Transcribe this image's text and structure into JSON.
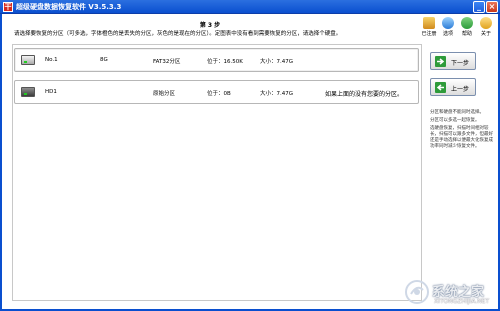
{
  "window": {
    "title": "超级硬盘数据恢复软件 V3.5.3.3",
    "icon": "app-logo-icon",
    "icon_glyph": "干"
  },
  "header": {
    "step": "第 3 步",
    "instruction": "请选择要恢复的分区（可多选，字体橙色的是丢失的分区，灰色的是现在的分区）。定图表中没有看到需要恢复的分区，请选择个硬盘。"
  },
  "top_icons": [
    {
      "name": "register-icon",
      "label": "已注册"
    },
    {
      "name": "options-icon",
      "label": "选项"
    },
    {
      "name": "help-icon",
      "label": "帮助"
    },
    {
      "name": "about-icon",
      "label": "关于"
    }
  ],
  "partitions": [
    {
      "name": "No.1",
      "size": "8G",
      "fs": "FAT32分区",
      "position": "位于：16.50K",
      "capacity": "大小：7.47G",
      "note": "",
      "icon": "drive-icon"
    },
    {
      "name": "HD1",
      "size": "",
      "fs": "原始分区",
      "position": "位于：0B",
      "capacity": "大小：7.47G",
      "note": "如果上面的没有您要的分区。",
      "icon": "hard-disk-icon"
    }
  ],
  "buttons": {
    "next": "下一步",
    "prev": "上一步"
  },
  "tips": [
    "分区和硬盘不能同时选择。",
    "分区可以多选一起恢复。",
    "选硬盘恢复，扫描时间相对较长，扫描可以跟多文件，但最好还是手动选择以便最大化恢复成功率同时减少恢复文件。"
  ],
  "watermark": {
    "text": "系统之家",
    "sub": "XITONGZHIJIA.NET"
  },
  "colors": {
    "titlebar": "#0a4fcf",
    "accent_green": "#2e9b3a"
  }
}
